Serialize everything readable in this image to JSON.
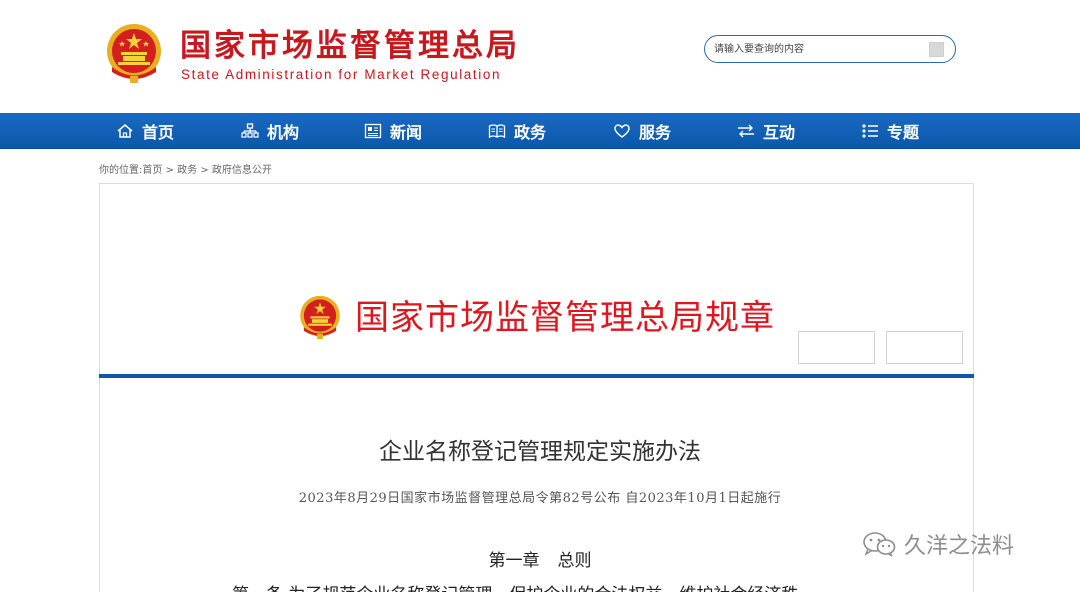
{
  "header": {
    "logo_cn": "国家市场监督管理总局",
    "logo_en": "State Administration for Market Regulation",
    "search_placeholder": "请输入要查询的内容"
  },
  "nav": [
    {
      "label": "首页",
      "icon": "home-icon"
    },
    {
      "label": "机构",
      "icon": "org-chart-icon"
    },
    {
      "label": "新闻",
      "icon": "news-icon"
    },
    {
      "label": "政务",
      "icon": "book-icon"
    },
    {
      "label": "服务",
      "icon": "heart-icon"
    },
    {
      "label": "互动",
      "icon": "exchange-arrows-icon"
    },
    {
      "label": "专题",
      "icon": "list-icon"
    }
  ],
  "breadcrumb": "你的位置:首页 > 政务 > 政府信息公开",
  "banner": {
    "title": "国家市场监督管理总局规章"
  },
  "document": {
    "title": "企业名称登记管理规定实施办法",
    "subtitle": "2023年8月29日国家市场监督管理总局令第82号公布  自2023年10月1日起施行",
    "chapter_num": "第一章",
    "chapter_name": "总则",
    "article_first_line": "第一条  为了规范企业名称登记管理，保护企业的合法权益，维护社会经济秩"
  },
  "watermark": {
    "text": "久洋之法料",
    "icon": "wechat-icon"
  },
  "colors": {
    "brand_red": "#c8171d",
    "nav_blue": "#0f5bad",
    "banner_red": "#e0151d"
  }
}
